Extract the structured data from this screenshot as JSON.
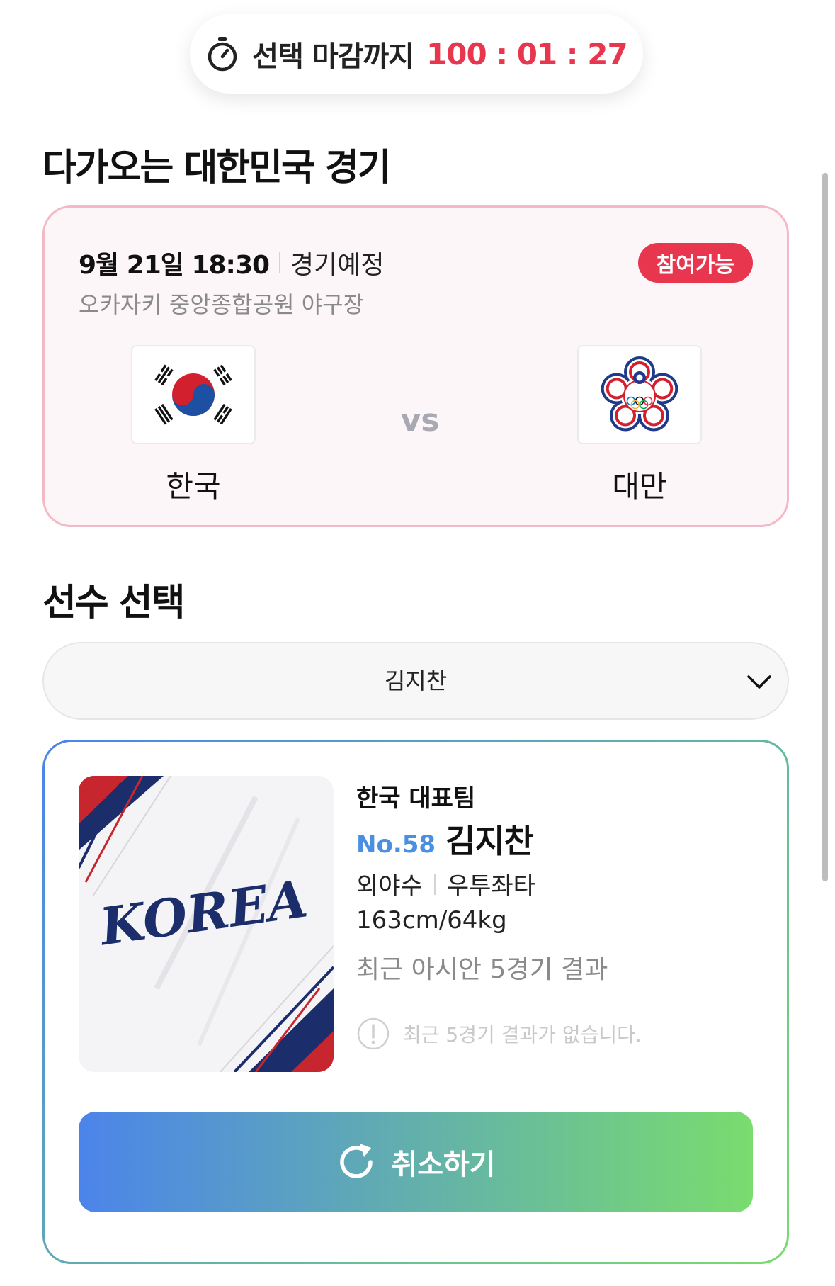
{
  "timer": {
    "label": "선택 마감까지",
    "time": "100 : 01 : 27"
  },
  "sections": {
    "upcoming_title": "다가오는 대한민국 경기",
    "select_title": "선수 선택"
  },
  "match": {
    "datetime": "9월 21일 18:30",
    "status": "경기예정",
    "venue": "오카자키 중앙종합공원 야구장",
    "badge": "참여가능",
    "vs": "vs",
    "home": {
      "name": "한국",
      "flag": "korea-flag"
    },
    "away": {
      "name": "대만",
      "flag": "chinese-taipei-olympic-flag"
    }
  },
  "player_select": {
    "value": "김지찬"
  },
  "player": {
    "image_text": "KOREA",
    "team": "한국 대표팀",
    "number": "No.58",
    "name": "김지찬",
    "position": "외야수",
    "bat_throw": "우투좌타",
    "body": "163cm/64kg",
    "recent_title": "최근 아시안 5경기 결과",
    "no_results": "최근 5경기 결과가 없습니다."
  },
  "cancel_button": {
    "label": "취소하기"
  },
  "colors": {
    "accent_red": "#e8364f",
    "accent_blue": "#4a90e2",
    "gradient_start": "#4c84ea",
    "gradient_end": "#79dc6e",
    "card_border_pink": "#f2b9c7"
  }
}
